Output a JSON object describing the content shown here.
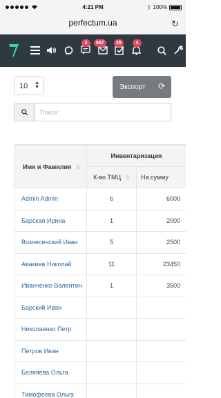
{
  "status_bar": {
    "time": "4:21 PM",
    "battery": "100%"
  },
  "browser": {
    "url": "perfectum.ua"
  },
  "navbar": {
    "badges": {
      "messages": "2",
      "mail": "687",
      "tasks": "25",
      "notifications": "4"
    }
  },
  "controls": {
    "page_length": "10",
    "export_label": "Экспорт",
    "search_placeholder": "Поиск:"
  },
  "table": {
    "headers": {
      "name": "Имя и Фамилия",
      "group": "Инвентаризация",
      "qty": "К-во ТМЦ",
      "sum": "На сумму"
    },
    "rows": [
      {
        "name": "Admin Admin",
        "qty": "6",
        "sum": "6000"
      },
      {
        "name": "Барская Ирина",
        "qty": "1",
        "sum": "2000"
      },
      {
        "name": "Вознесенский Иван",
        "qty": "5",
        "sum": "2500"
      },
      {
        "name": "Авакиев Николай",
        "qty": "11",
        "sum": "23450"
      },
      {
        "name": "Иванченко Валентин",
        "qty": "1",
        "sum": "3500"
      },
      {
        "name": "Барский Иван",
        "qty": "",
        "sum": ""
      },
      {
        "name": "Николаенко Петр",
        "qty": "",
        "sum": ""
      },
      {
        "name": "Петров Иван",
        "qty": "",
        "sum": ""
      },
      {
        "name": "Беляяева Ольга",
        "qty": "",
        "sum": ""
      },
      {
        "name": "Тимофеева Ольга",
        "qty": "",
        "sum": ""
      }
    ]
  },
  "colors": {
    "navbar": "#2f3940",
    "badge": "#e5495e",
    "link": "#2f6aa0",
    "logo": "#2fd9a4",
    "export": "#777b7f"
  }
}
